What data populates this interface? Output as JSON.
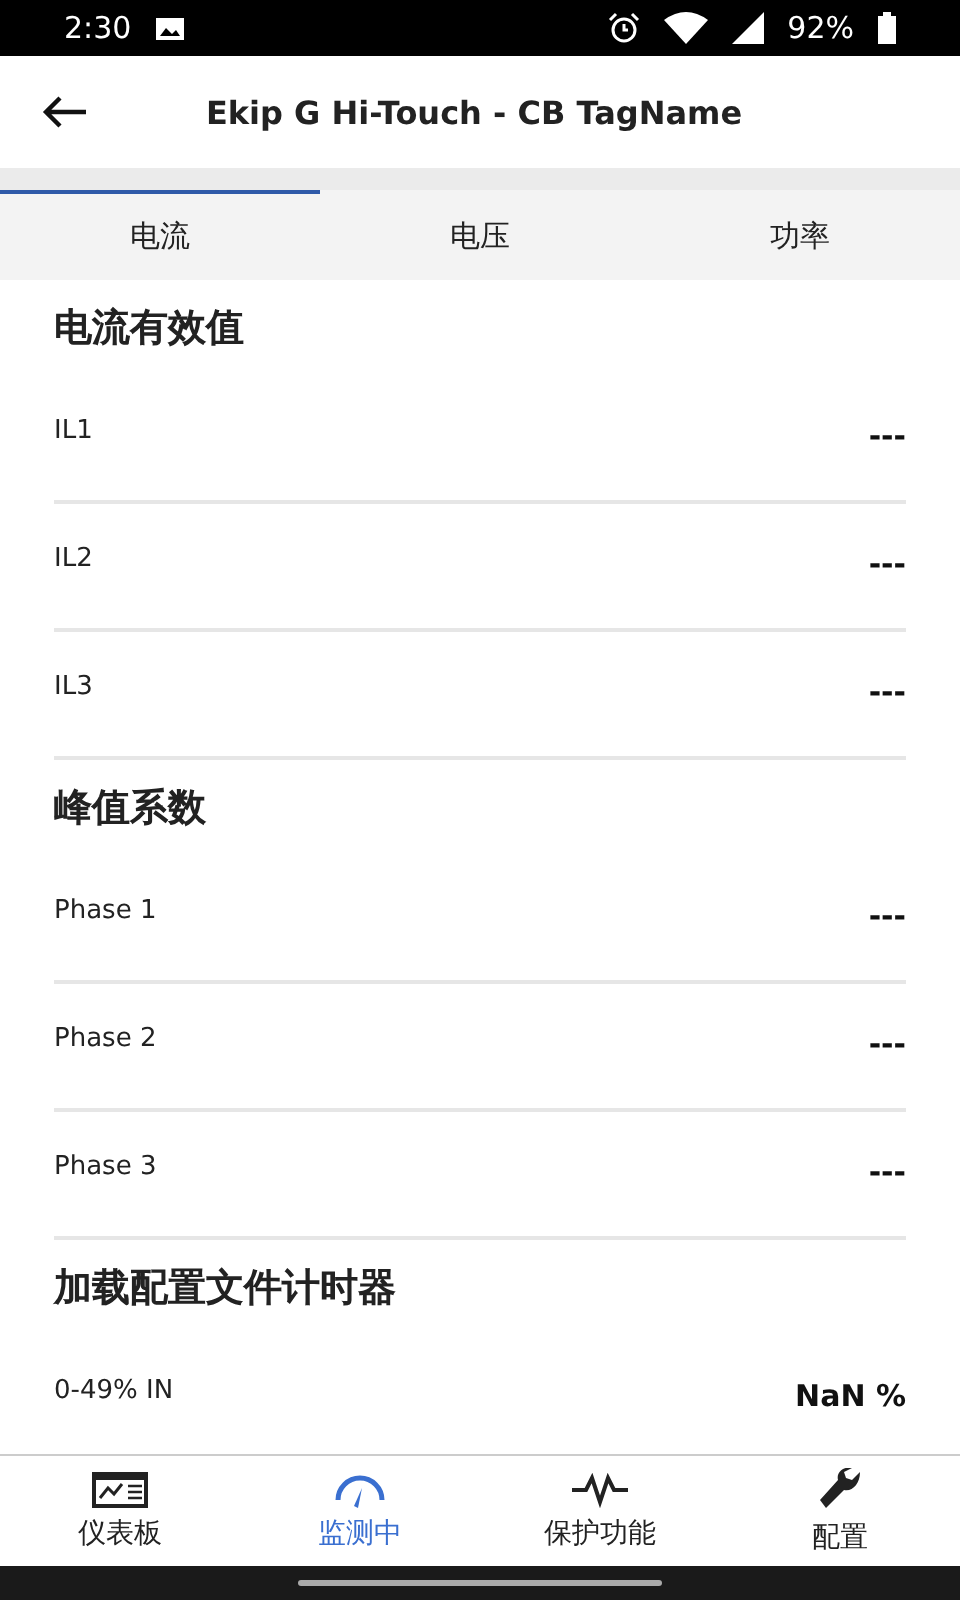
{
  "status_bar": {
    "time": "2:30",
    "battery": "92%"
  },
  "app_bar": {
    "title": "Ekip G Hi-Touch - CB TagName"
  },
  "tabs": [
    {
      "label": "电流",
      "selected": true
    },
    {
      "label": "电压",
      "selected": false
    },
    {
      "label": "功率",
      "selected": false
    }
  ],
  "sections": [
    {
      "title": "电流有效值",
      "rows": [
        {
          "label": "IL1",
          "value": "---"
        },
        {
          "label": "IL2",
          "value": "---"
        },
        {
          "label": "IL3",
          "value": "---"
        }
      ]
    },
    {
      "title": "峰值系数",
      "rows": [
        {
          "label": "Phase 1",
          "value": "---"
        },
        {
          "label": "Phase 2",
          "value": "---"
        },
        {
          "label": "Phase 3",
          "value": "---"
        }
      ]
    },
    {
      "title": "加载配置文件计时器",
      "rows": [
        {
          "label": "0-49% IN",
          "value": "NaN %"
        }
      ]
    }
  ],
  "bottom_nav": [
    {
      "kind": "dashboard",
      "label": "仪表板",
      "selected": false
    },
    {
      "kind": "gauge",
      "label": "监测中",
      "selected": true
    },
    {
      "kind": "pulse",
      "label": "保护功能",
      "selected": false
    },
    {
      "kind": "wrench",
      "label": "配置",
      "selected": false
    }
  ]
}
